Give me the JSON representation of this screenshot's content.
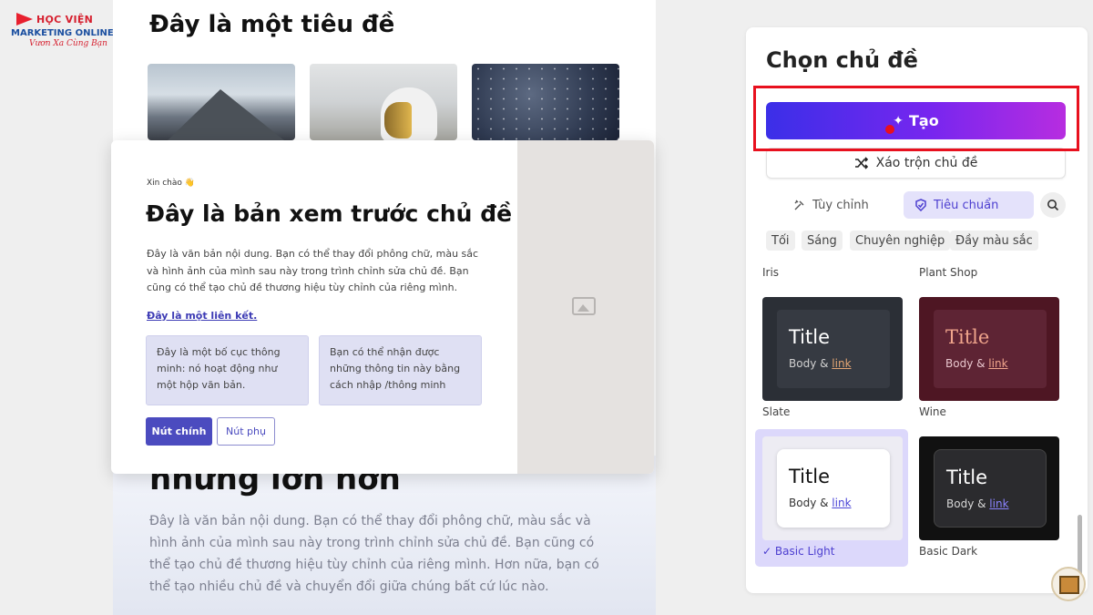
{
  "logo": {
    "line1": "HỌC VIỆN",
    "line2": "MARKETING ONLINE",
    "line3": "Vươn Xa Cùng Bạn"
  },
  "document": {
    "title": "Đây là một tiêu đề",
    "lower_heading": "nhưng lớn hơn",
    "lower_body": "Đây là văn bản nội dung. Bạn có thể thay đổi phông chữ, màu sắc và hình ảnh của mình sau này trong trình chỉnh sửa chủ đề. Bạn cũng có thể tạo chủ đề thương hiệu tùy chỉnh của riêng mình. Hơn nữa, bạn có thể tạo nhiều chủ đề và chuyển đổi giữa chúng bất cứ lúc nào."
  },
  "preview": {
    "greeting": "Xin chào 👋",
    "title": "Đây là bản xem trước chủ đề",
    "body": "Đây là văn bản nội dung. Bạn có thể thay đổi phông chữ, màu sắc và hình ảnh của mình sau này trong trình chỉnh sửa chủ đề. Bạn cũng có thể tạo chủ đề thương hiệu tùy chỉnh của riêng mình.",
    "link": "Đây là một liên kết.",
    "box1": "Đây là một bố cục thông minh: nó hoạt động như một hộp văn bản.",
    "box2": "Bạn có thể nhận được những thông tin này bằng cách nhập /thông minh",
    "primary_button": "Nút chính",
    "secondary_button": "Nút phụ"
  },
  "panel": {
    "title": "Chọn chủ đề",
    "create_button": "Tạo",
    "shuffle_button": "Xáo trộn chủ đề",
    "tabs": {
      "custom": "Tùy chỉnh",
      "standard": "Tiêu chuẩn"
    },
    "filters": [
      "Tối",
      "Sáng",
      "Chuyên nghiệp",
      "Đầy màu sắc"
    ],
    "top_labels": {
      "left": "Iris",
      "right": "Plant Shop"
    },
    "themes": [
      {
        "name": "Slate",
        "title": "Title",
        "body": "Body &",
        "link": "link"
      },
      {
        "name": "Wine",
        "title": "Title",
        "body": "Body &",
        "link": "link"
      },
      {
        "name": "Basic Light",
        "title": "Title",
        "body": "Body &",
        "link": "link",
        "selected": true
      },
      {
        "name": "Basic Dark",
        "title": "Title",
        "body": "Body &",
        "link": "link"
      }
    ]
  },
  "colors": {
    "accent": "#4d3fd0",
    "create_gradient_start": "#3b2fe8",
    "create_gradient_end": "#b72de0",
    "highlight_border": "#e8101e"
  }
}
